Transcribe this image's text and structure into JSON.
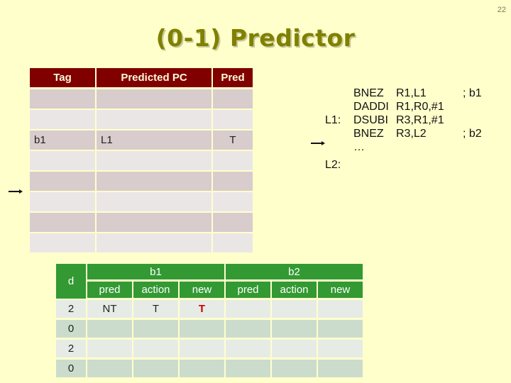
{
  "page_number": "22",
  "title": "(0-1) Predictor",
  "predictor_table": {
    "headers": [
      "Tag",
      "Predicted PC",
      "Pred"
    ],
    "rows": [
      [
        "",
        "",
        ""
      ],
      [
        "",
        "",
        ""
      ],
      [
        "b1",
        "L1",
        "T"
      ],
      [
        "",
        "",
        ""
      ],
      [
        "",
        "",
        ""
      ],
      [
        "",
        "",
        ""
      ],
      [
        "",
        "",
        ""
      ],
      [
        "",
        "",
        ""
      ]
    ],
    "pointer_row_index": 5
  },
  "code": {
    "lines": [
      {
        "label": "",
        "op": "BNEZ",
        "args": "R1,L1",
        "comment": "; b1"
      },
      {
        "label": "",
        "op": "DADDI",
        "args": "R1,R0,#1",
        "comment": ""
      },
      {
        "label": "L1:",
        "op": "DSUBI",
        "args": "R3,R1,#1",
        "comment": ""
      },
      {
        "label": "",
        "op": "BNEZ",
        "args": "R3,L2",
        "comment": "; b2"
      },
      {
        "label": "",
        "op": "…",
        "args": "",
        "comment": ""
      },
      {
        "label": "L2:",
        "op": "",
        "args": "",
        "comment": ""
      }
    ],
    "pointer_line_index": 3
  },
  "trace_table": {
    "d_header": "d",
    "groups": [
      "b1",
      "b2"
    ],
    "sub_headers": [
      "pred",
      "action",
      "new",
      "pred",
      "action",
      "new"
    ],
    "rows": [
      [
        "2",
        "NT",
        "T",
        "T",
        "",
        "",
        ""
      ],
      [
        "0",
        "",
        "",
        "",
        "",
        "",
        ""
      ],
      [
        "2",
        "",
        "",
        "",
        "",
        "",
        ""
      ],
      [
        "0",
        "",
        "",
        "",
        "",
        "",
        ""
      ]
    ],
    "highlight": {
      "row": 0,
      "col": 3,
      "color": "#cc0000"
    }
  },
  "colors": {
    "background": "#ffffcc",
    "title": "#808000",
    "btb_header": "#800000",
    "trace_header": "#339933"
  }
}
